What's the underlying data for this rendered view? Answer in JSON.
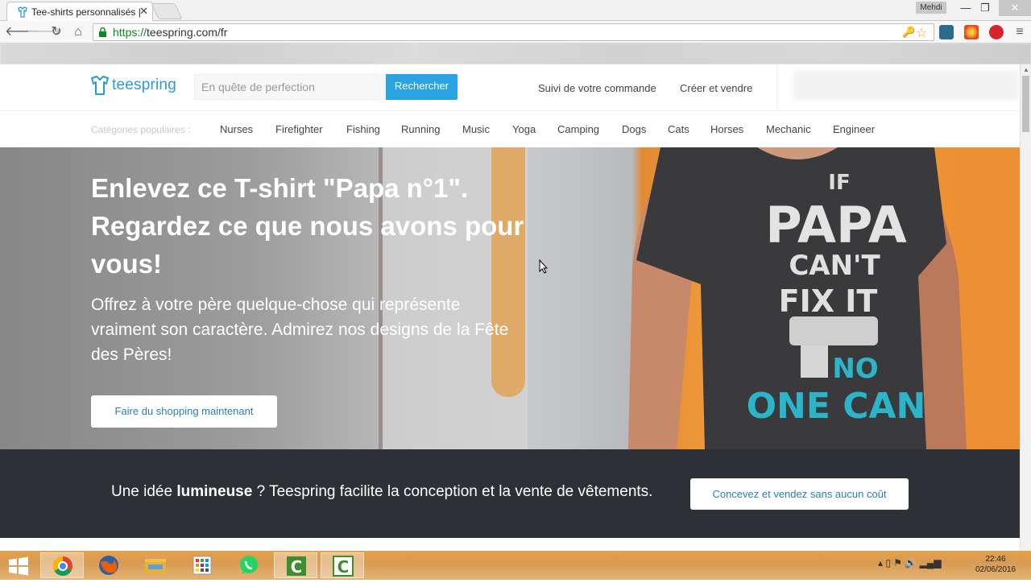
{
  "browser": {
    "tab_title": "Tee-shirts personnalisés |",
    "tab_close": "✕",
    "profile": "Mehdi",
    "url_scheme": "https://",
    "url_rest": "teespring.com/fr"
  },
  "header": {
    "logo_text": "teespring",
    "search_placeholder": "En quête de perfection",
    "search_button": "Rechercher",
    "link_track": "Suivi de votre commande",
    "link_create": "Créer et vendre"
  },
  "categories": {
    "label": "Catégories populaires :",
    "items": [
      "Nurses",
      "Firefighter",
      "Fishing",
      "Running",
      "Music",
      "Yoga",
      "Camping",
      "Dogs",
      "Cats",
      "Horses",
      "Mechanic",
      "Engineer"
    ]
  },
  "hero": {
    "title": "Enlevez ce T-shirt \"Papa n°1\". Regardez ce que nous avons pour vous!",
    "subtitle": "Offrez à votre père quelque-chose qui représente vraiment son caractère. Admirez nos designs de la Fête des Pères!",
    "button": "Faire du shopping maintenant",
    "shirt_lines": [
      "IF",
      "PAPA",
      "CAN'T",
      "FIX IT",
      "NO",
      "ONE CAN"
    ]
  },
  "band": {
    "text_pre": "Une idée ",
    "text_bold": "lumineuse",
    "text_post": " ? Teespring facilite la conception et la vente de vêtements.",
    "button": "Concevez et vendez sans aucun coût"
  },
  "taskbar": {
    "time": "22:46",
    "date": "02/06/2016"
  },
  "colors": {
    "brand": "#2aa3e3",
    "band": "#2d3135",
    "hero_orange": "#ec8e32"
  }
}
